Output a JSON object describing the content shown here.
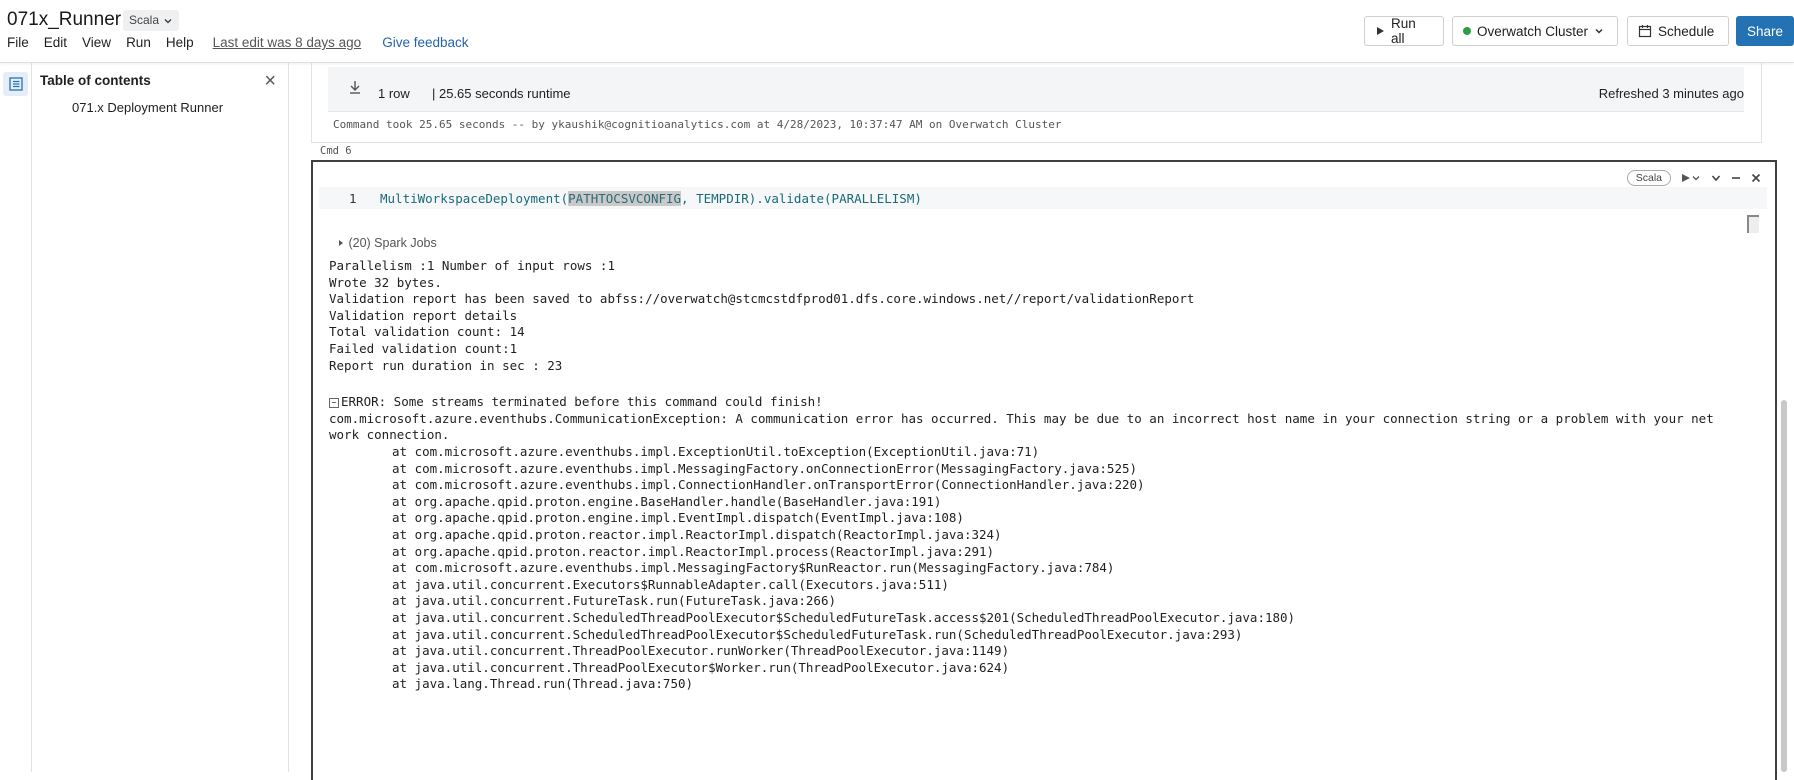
{
  "header": {
    "title": "071x_Runner",
    "language": "Scala",
    "menu": [
      "File",
      "Edit",
      "View",
      "Run",
      "Help"
    ],
    "last_edit": "Last edit was 8 days ago",
    "feedback": "Give feedback",
    "run_all": "Run all",
    "cluster": "Overwatch Cluster",
    "schedule": "Schedule",
    "share": "Share"
  },
  "toc": {
    "title": "Table of contents",
    "items": [
      "071.x Deployment Runner"
    ]
  },
  "cell5": {
    "rows": "1 row",
    "runtime": "|  25.65 seconds runtime",
    "refreshed": "Refreshed 3 minutes ago",
    "cmd_info": "Command took 25.65 seconds -- by ykaushik@cognitioanalytics.com at 4/28/2023, 10:37:47 AM on Overwatch Cluster"
  },
  "cell6": {
    "label": "Cmd 6",
    "language": "Scala",
    "line_number": "1",
    "code_fn": "MultiWorkspaceDeployment(",
    "code_hl": "PATHTOCSVCONFIG",
    "code_rest": ", TEMPDIR).validate(PARALLELISM)",
    "spark_jobs": "(20) Spark Jobs",
    "output": [
      "Parallelism :1 Number of input rows :1",
      "Wrote 32 bytes.",
      "Validation report has been saved to abfss://overwatch@stcmcstdfprod01.dfs.core.windows.net//report/validationReport",
      "Validation report details",
      "Total validation count: 14",
      "Failed validation count:1",
      "Report run duration in sec : 23"
    ],
    "error_title": "ERROR: Some streams terminated before this command could finish!",
    "error_msg_1": "com.microsoft.azure.eventhubs.CommunicationException: A communication error has occurred. This may be due to an incorrect host name in your connection string or a problem with your net",
    "error_msg_2": "work connection.",
    "stack": [
      "at com.microsoft.azure.eventhubs.impl.ExceptionUtil.toException(ExceptionUtil.java:71)",
      "at com.microsoft.azure.eventhubs.impl.MessagingFactory.onConnectionError(MessagingFactory.java:525)",
      "at com.microsoft.azure.eventhubs.impl.ConnectionHandler.onTransportError(ConnectionHandler.java:220)",
      "at org.apache.qpid.proton.engine.BaseHandler.handle(BaseHandler.java:191)",
      "at org.apache.qpid.proton.engine.impl.EventImpl.dispatch(EventImpl.java:108)",
      "at org.apache.qpid.proton.reactor.impl.ReactorImpl.dispatch(ReactorImpl.java:324)",
      "at org.apache.qpid.proton.reactor.impl.ReactorImpl.process(ReactorImpl.java:291)",
      "at com.microsoft.azure.eventhubs.impl.MessagingFactory$RunReactor.run(MessagingFactory.java:784)",
      "at java.util.concurrent.Executors$RunnableAdapter.call(Executors.java:511)",
      "at java.util.concurrent.FutureTask.run(FutureTask.java:266)",
      "at java.util.concurrent.ScheduledThreadPoolExecutor$ScheduledFutureTask.access$201(ScheduledThreadPoolExecutor.java:180)",
      "at java.util.concurrent.ScheduledThreadPoolExecutor$ScheduledFutureTask.run(ScheduledThreadPoolExecutor.java:293)",
      "at java.util.concurrent.ThreadPoolExecutor.runWorker(ThreadPoolExecutor.java:1149)",
      "at java.util.concurrent.ThreadPoolExecutor$Worker.run(ThreadPoolExecutor.java:624)",
      "at java.lang.Thread.run(Thread.java:750)"
    ]
  },
  "colors": {
    "accent": "#2272b4",
    "cluster_status": "#2e9e44",
    "link": "#2563b0"
  }
}
